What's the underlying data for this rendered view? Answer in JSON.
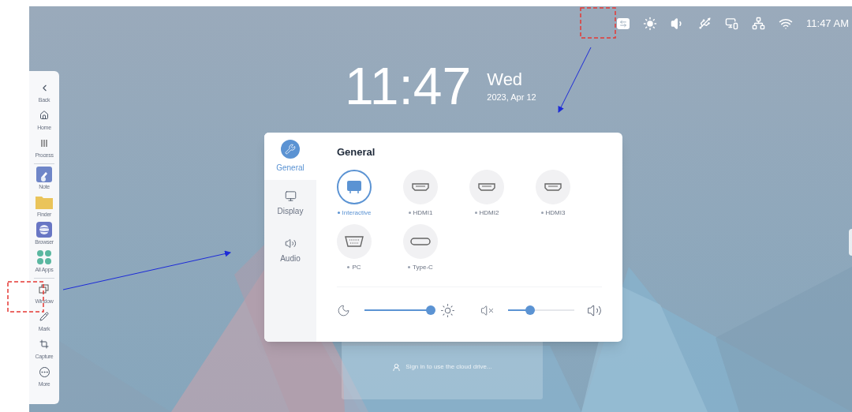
{
  "status_bar": {
    "time": "11:47 AM"
  },
  "clock": {
    "time": "11:47",
    "weekday": "Wed",
    "date": "2023, Apr 12"
  },
  "sidebar": {
    "items": [
      {
        "label": "Back",
        "kind": "back"
      },
      {
        "label": "Home",
        "kind": "home"
      },
      {
        "label": "Process",
        "kind": "process"
      },
      {
        "label": "Note",
        "kind": "note"
      },
      {
        "label": "Finder",
        "kind": "finder"
      },
      {
        "label": "Browser",
        "kind": "browser"
      },
      {
        "label": "All Apps",
        "kind": "apps"
      },
      {
        "label": "Window",
        "kind": "window"
      },
      {
        "label": "Mark",
        "kind": "mark"
      },
      {
        "label": "Capture",
        "kind": "capture"
      },
      {
        "label": "More",
        "kind": "more"
      }
    ]
  },
  "settings_panel": {
    "tabs": [
      {
        "label": "General",
        "kind": "general",
        "selected": true
      },
      {
        "label": "Display",
        "kind": "display",
        "selected": false
      },
      {
        "label": "Audio",
        "kind": "audio",
        "selected": false
      }
    ],
    "title": "General",
    "sources": [
      {
        "label": "Interactive",
        "kind": "screen",
        "selected": true
      },
      {
        "label": "HDMI1",
        "kind": "hdmi",
        "selected": false
      },
      {
        "label": "HDMI2",
        "kind": "hdmi",
        "selected": false
      },
      {
        "label": "HDMI3",
        "kind": "hdmi",
        "selected": false
      },
      {
        "label": "PC",
        "kind": "vga",
        "selected": false
      },
      {
        "label": "Type-C",
        "kind": "typec",
        "selected": false
      }
    ],
    "brightness": {
      "level": 1
    },
    "volume": {
      "level": 0.33
    }
  },
  "cloud_drive": {
    "message": "Sign in to use the cloud drive..."
  }
}
